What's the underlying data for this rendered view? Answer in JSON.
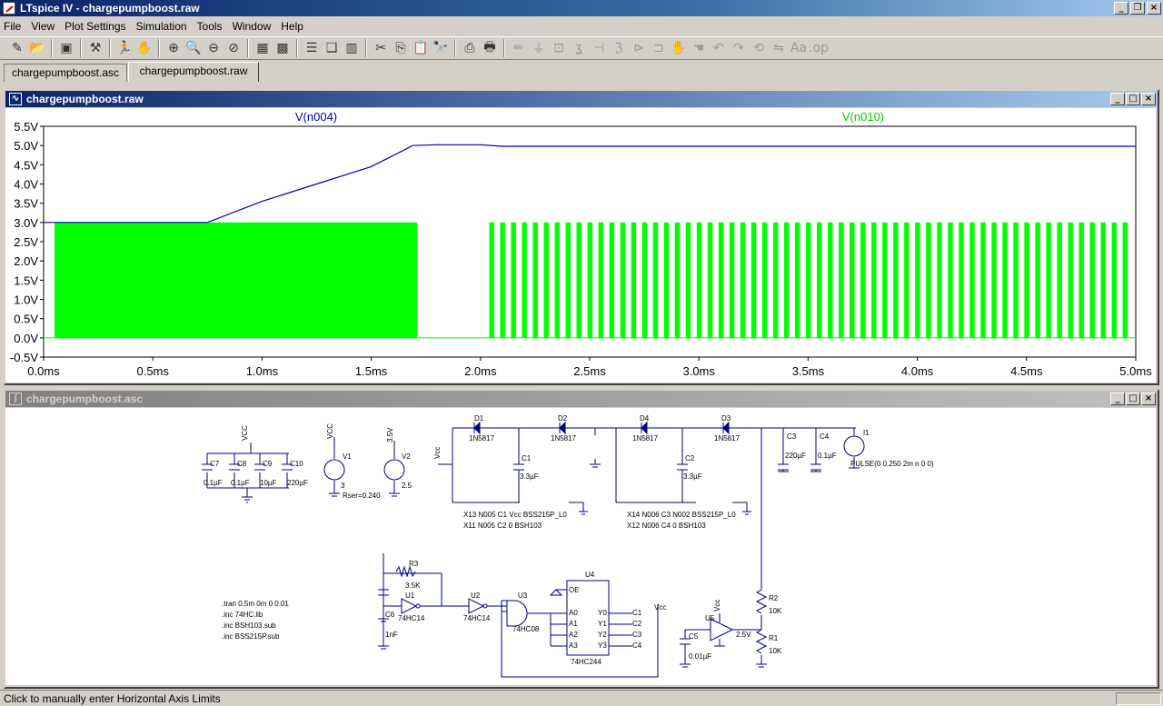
{
  "window": {
    "title": "LTspice IV - chargepumpboost.raw"
  },
  "menu": [
    "File",
    "View",
    "Plot Settings",
    "Simulation",
    "Tools",
    "Window",
    "Help"
  ],
  "tabs": [
    "chargepumpboost.asc",
    "chargepumpboost.raw"
  ],
  "plot_window": {
    "title": "chargepumpboost.raw"
  },
  "schematic_window": {
    "title": "chargepumpboost.asc"
  },
  "status": "Click to manually enter Horizontal Axis Limits",
  "colors": {
    "trace1": "#0000b0",
    "trace2": "#00ff00"
  },
  "chart_data": {
    "type": "line",
    "xlabel": "",
    "ylabel": "",
    "xlim": [
      0,
      5.0
    ],
    "ylim": [
      -0.5,
      5.5
    ],
    "x_ticks": [
      "0.0ms",
      "0.5ms",
      "1.0ms",
      "1.5ms",
      "2.0ms",
      "2.5ms",
      "3.0ms",
      "3.5ms",
      "4.0ms",
      "4.5ms",
      "5.0ms"
    ],
    "y_ticks": [
      "-0.5V",
      "0.0V",
      "0.5V",
      "1.0V",
      "1.5V",
      "2.0V",
      "2.5V",
      "3.0V",
      "3.5V",
      "4.0V",
      "4.5V",
      "5.0V",
      "5.5V"
    ],
    "grid": false,
    "series": [
      {
        "name": "V(n004)",
        "color": "#0000b0",
        "x": [
          0.0,
          0.05,
          0.75,
          1.0,
          1.25,
          1.5,
          1.69,
          1.8,
          2.0,
          2.1,
          5.0
        ],
        "y": [
          3.0,
          3.0,
          3.0,
          3.55,
          4.0,
          4.45,
          5.0,
          5.02,
          5.02,
          4.98,
          4.98
        ]
      },
      {
        "name": "V(n010)",
        "color": "#00ff00",
        "type": "pulse-train",
        "low": 0.0,
        "high": 3.0,
        "bursts": [
          {
            "start": 0.05,
            "end": 1.71,
            "solid": true
          },
          {
            "start": 2.04,
            "end": 4.98,
            "period": 0.05,
            "duty": 0.45
          }
        ]
      }
    ]
  },
  "schematic_labels": [
    "D1",
    "1N5817",
    "D2",
    "1N5817",
    "D4",
    "1N5817",
    "D3",
    "1N5817",
    "C1",
    "3.3µF",
    "C2",
    "3.3µF",
    "C3",
    "220µF",
    "C4",
    "0.1µF",
    "I1",
    "PULSE(0 0.250 2m n 0 0)",
    "VCC",
    "C7",
    "0.1µF",
    "C8",
    "0.1µF",
    "C9",
    "10µF",
    "C10",
    "220µF",
    "VCC",
    "V1",
    "3",
    "Rser=0.240",
    "3.5V",
    "V2",
    "2.5",
    "Vcc",
    "X13 N005 C1 Vcc BSS215P_L0",
    "X11 N005 C2 0 BSH103",
    "X14 N006 C3 N002 BSS215P_L0",
    "X12 N006 C4 0 BSH103",
    "R3",
    "3.5K",
    "U1",
    "74HC14",
    "U2",
    "74HC14",
    "C6",
    "1nF",
    "U3",
    "74HC08",
    "U4",
    "OE",
    "A0",
    "A1",
    "A2",
    "A3",
    "Y0",
    "Y1",
    "Y2",
    "Y3",
    "C1",
    "C2",
    "C3",
    "C4",
    "74HC244",
    "Vcc",
    "Vcc",
    "U5",
    "2.5V",
    "C5",
    "0.01µF",
    "R2",
    "10K",
    "R1",
    "10K",
    ".tran 0.5m 0m 0 0.01",
    ".inc 74HC.lib",
    ".inc BSH103.sub",
    ".inc BSS215P.sub"
  ]
}
